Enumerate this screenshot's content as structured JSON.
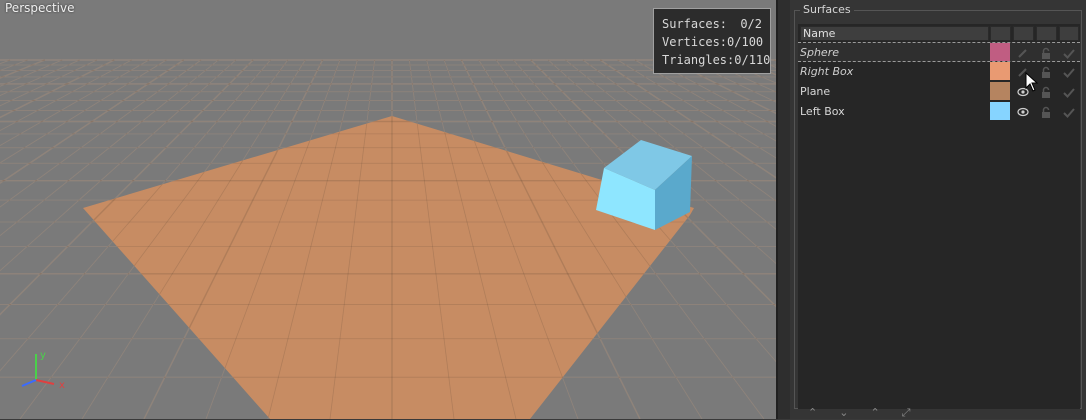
{
  "viewport": {
    "label": "Perspective",
    "stats": [
      {
        "label": "Surfaces:",
        "value": "0/2"
      },
      {
        "label": "Vertices:",
        "value": "0/100"
      },
      {
        "label": "Triangles:",
        "value": "0/110"
      }
    ],
    "axis_labels": {
      "x": "x",
      "y": "y"
    },
    "colors": {
      "background": "#7a7a7a",
      "plane": "#d58f5f",
      "box": "#8fe4ff",
      "grid": "#8c8c8c"
    }
  },
  "surfaces_panel": {
    "title": "Surfaces",
    "column_name": "Name",
    "rows": [
      {
        "name": "Sphere",
        "color": "#c05d82",
        "italic": true,
        "selected": true,
        "visible_icon": "pencil-icon"
      },
      {
        "name": "Right Box",
        "color": "#e99a72",
        "italic": true,
        "selected": false,
        "visible_icon": "pencil-icon"
      },
      {
        "name": "Plane",
        "color": "#b58460",
        "italic": false,
        "selected": false,
        "visible_icon": "eye-icon"
      },
      {
        "name": "Left Box",
        "color": "#86d4ff",
        "italic": false,
        "selected": false,
        "visible_icon": "eye-icon"
      }
    ]
  }
}
